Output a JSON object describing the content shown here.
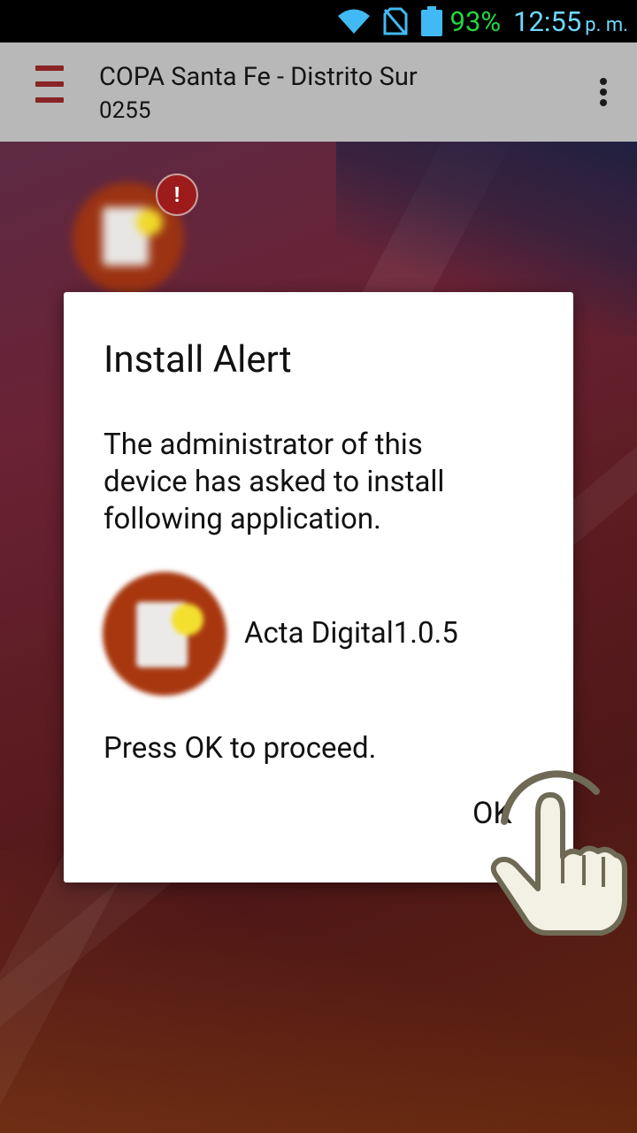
{
  "status_bar": {
    "battery_percent": "93%",
    "time": "12:55",
    "ampm": "p. m.",
    "icons": [
      "wifi-icon",
      "no-sim-icon",
      "battery-icon"
    ]
  },
  "header": {
    "title": "COPA Santa Fe - Distrito Sur",
    "subtitle": "0255",
    "menu_icon": "hamburger-icon",
    "overflow_icon": "more-vert-icon"
  },
  "background": {
    "badge_text": "!"
  },
  "dialog": {
    "title": "Install Alert",
    "message": "The administrator of this device has asked to install following application.",
    "app_name": "Acta Digital1.0.5",
    "proceed_text": "Press OK to proceed.",
    "ok_label": "OK"
  },
  "colors": {
    "battery": "#23d93f",
    "clock": "#6fd8ff",
    "header_bg": "#b8b8b8",
    "menu_icon": "#8a2424",
    "badge": "#9d1b1b"
  }
}
